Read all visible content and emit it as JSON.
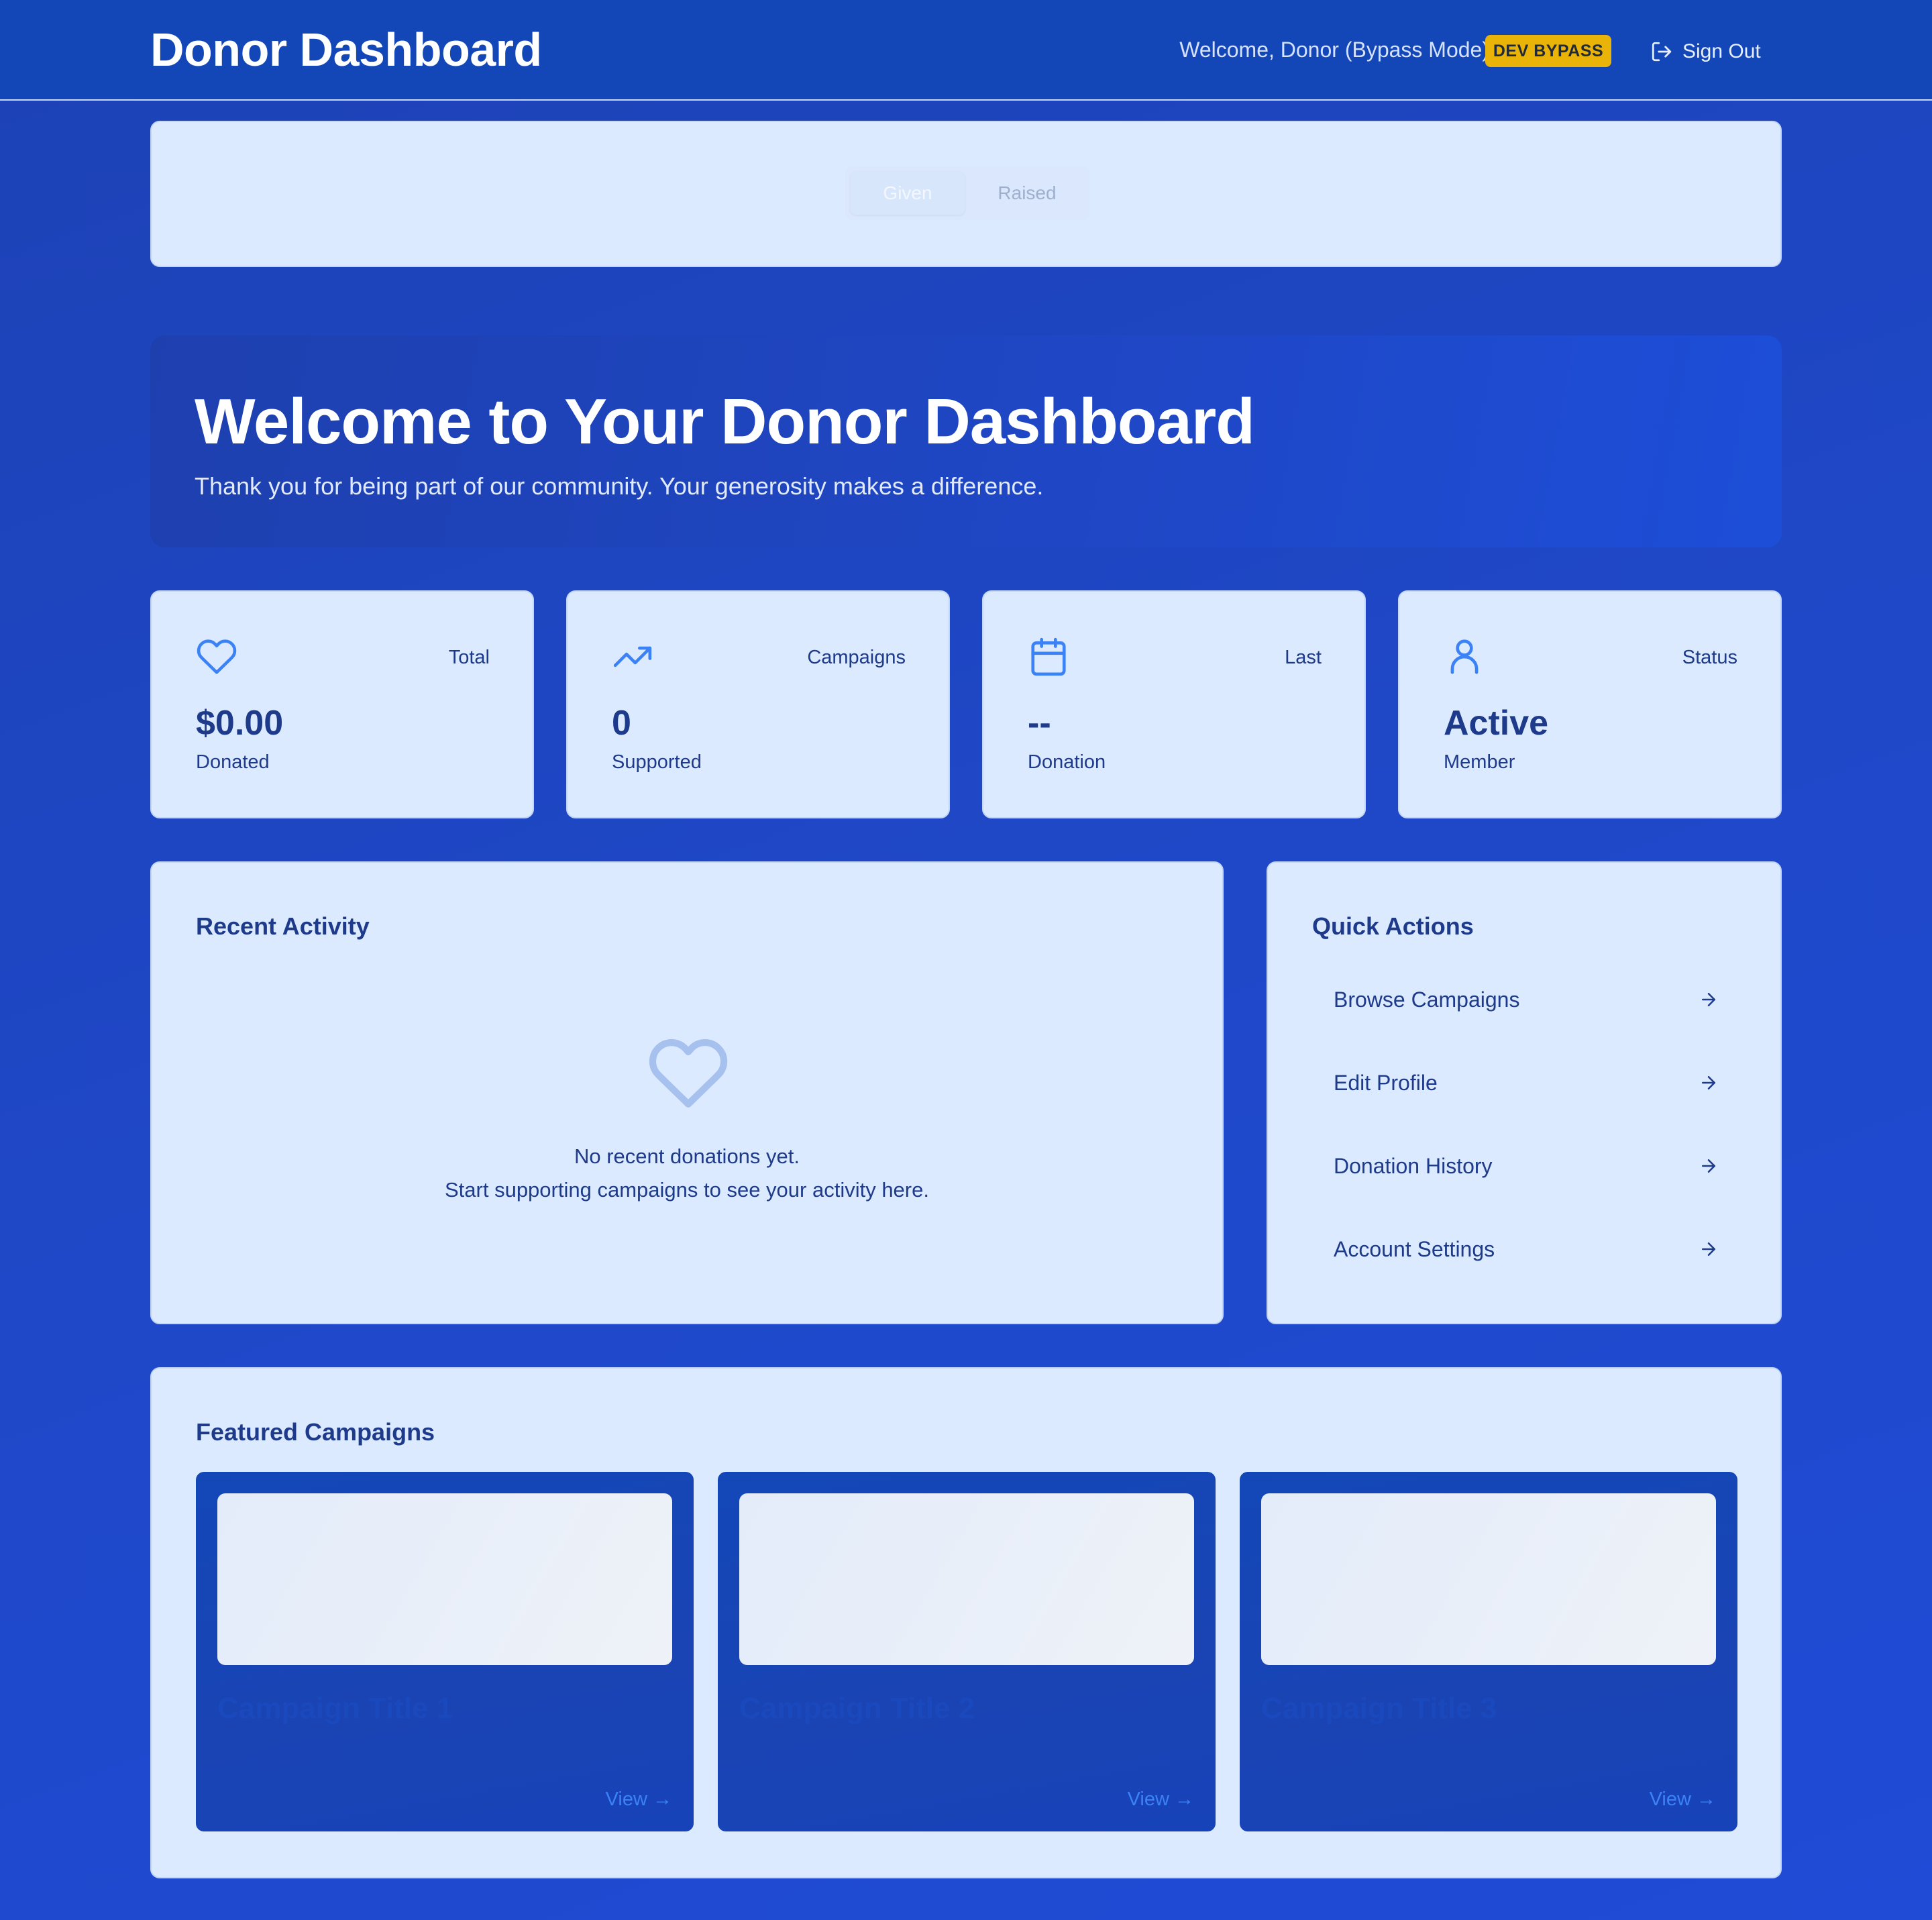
{
  "header": {
    "title": "Donor Dashboard",
    "welcome": "Welcome, Donor (Bypass Mode)",
    "badge": "DEV BYPASS",
    "signout": "Sign Out"
  },
  "toggle": {
    "given": "Given",
    "raised": "Raised",
    "active": "Given"
  },
  "hero": {
    "title": "Welcome to Your Donor Dashboard",
    "subtitle": "Thank you for being part of our community. Your generosity makes a difference."
  },
  "stats": [
    {
      "icon": "heart-icon",
      "label": "Total",
      "value": "$0.00",
      "sub": "Donated"
    },
    {
      "icon": "trending-up-icon",
      "label": "Campaigns",
      "value": "0",
      "sub": "Supported"
    },
    {
      "icon": "calendar-icon",
      "label": "Last",
      "value": "--",
      "sub": "Donation"
    },
    {
      "icon": "user-icon",
      "label": "Status",
      "value": "Active",
      "sub": "Member"
    }
  ],
  "activity": {
    "title": "Recent Activity",
    "empty_line1": "No recent donations yet.",
    "empty_line2": "Start supporting campaigns to see your activity here."
  },
  "quick_actions": {
    "title": "Quick Actions",
    "items": [
      {
        "label": "Browse Campaigns"
      },
      {
        "label": "Edit Profile"
      },
      {
        "label": "Donation History"
      },
      {
        "label": "Account Settings"
      }
    ]
  },
  "featured": {
    "title": "Featured Campaigns",
    "campaigns": [
      {
        "title": "Campaign Title 1",
        "view": "View →"
      },
      {
        "title": "Campaign Title 2",
        "view": "View →"
      },
      {
        "title": "Campaign Title 3",
        "view": "View →"
      }
    ]
  },
  "colors": {
    "accent": "#3b82f6",
    "header_bg": "#1347b8",
    "card_bg": "#dbeafe",
    "badge": "#eab308",
    "text_dark": "#1e3a8a"
  }
}
